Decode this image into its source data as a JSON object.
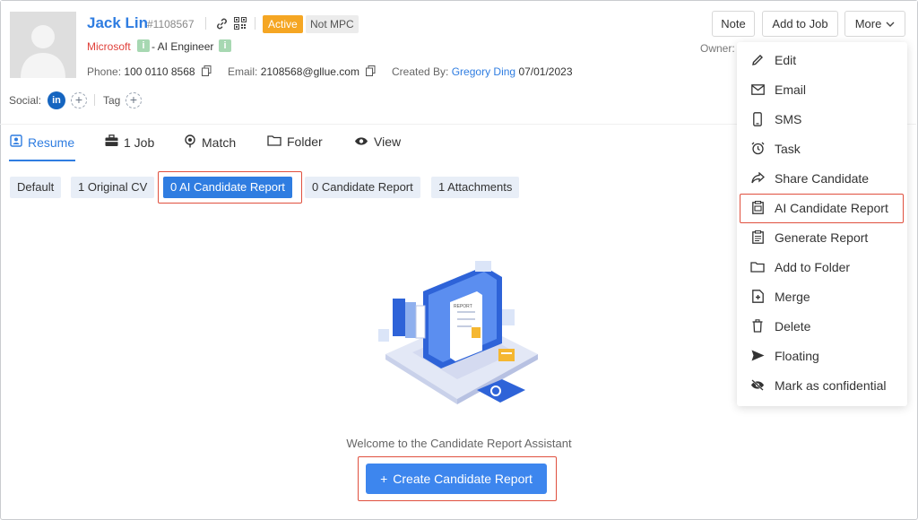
{
  "candidate": {
    "name": "Jack Lin",
    "id": "#1108567",
    "status": "Active",
    "mpc": "Not MPC",
    "company": "Microsoft",
    "title": "- AI Engineer",
    "phone_label": "Phone:",
    "phone": "100 0110 8568",
    "email_label": "Email:",
    "email": "2108568@gllue.com",
    "created_label": "Created By:",
    "created_by": "Gregory Ding",
    "created_date": "07/01/2023",
    "social_label": "Social:",
    "tag_label": "Tag",
    "linkedin": "in",
    "owner_label": "Owner:",
    "info_badge": "i"
  },
  "actions": {
    "note": "Note",
    "add_to_job": "Add to Job",
    "more": "More"
  },
  "tabs": [
    {
      "label": "Resume",
      "icon": "resume-icon"
    },
    {
      "label": "1 Job",
      "icon": "briefcase-icon"
    },
    {
      "label": "Match",
      "icon": "match-icon"
    },
    {
      "label": "Folder",
      "icon": "folder-icon"
    },
    {
      "label": "View",
      "icon": "eye-icon"
    }
  ],
  "chips": [
    {
      "label": "Default"
    },
    {
      "label": "1 Original CV"
    },
    {
      "label": "0 AI Candidate Report"
    },
    {
      "label": "0 Candidate Report"
    },
    {
      "label": "1 Attachments"
    }
  ],
  "main": {
    "welcome": "Welcome to the Candidate Report Assistant",
    "create_button": "Create Candidate Report",
    "create_button_plus": "+",
    "illustration_label": "REPORT"
  },
  "menu": {
    "items": [
      {
        "label": "Edit",
        "icon": "pencil-icon"
      },
      {
        "label": "Email",
        "icon": "envelope-icon"
      },
      {
        "label": "SMS",
        "icon": "phone-icon"
      },
      {
        "label": "Task",
        "icon": "alarm-clock-icon"
      },
      {
        "label": "Share Candidate",
        "icon": "share-icon"
      },
      {
        "label": "AI Candidate Report",
        "icon": "ai-report-icon"
      },
      {
        "label": "Generate Report",
        "icon": "clipboard-icon"
      },
      {
        "label": "Add to Folder",
        "icon": "folder-icon"
      },
      {
        "label": "Merge",
        "icon": "merge-file-icon"
      },
      {
        "label": "Delete",
        "icon": "trash-icon"
      },
      {
        "label": "Floating",
        "icon": "send-icon"
      },
      {
        "label": "Mark as confidential",
        "icon": "eye-off-icon"
      }
    ]
  },
  "colors": {
    "accent": "#2f7de1",
    "active_badge": "#f5a623",
    "company_red": "#e0403a",
    "highlight_border": "#e0503e",
    "primary_button": "#3d86ee"
  }
}
